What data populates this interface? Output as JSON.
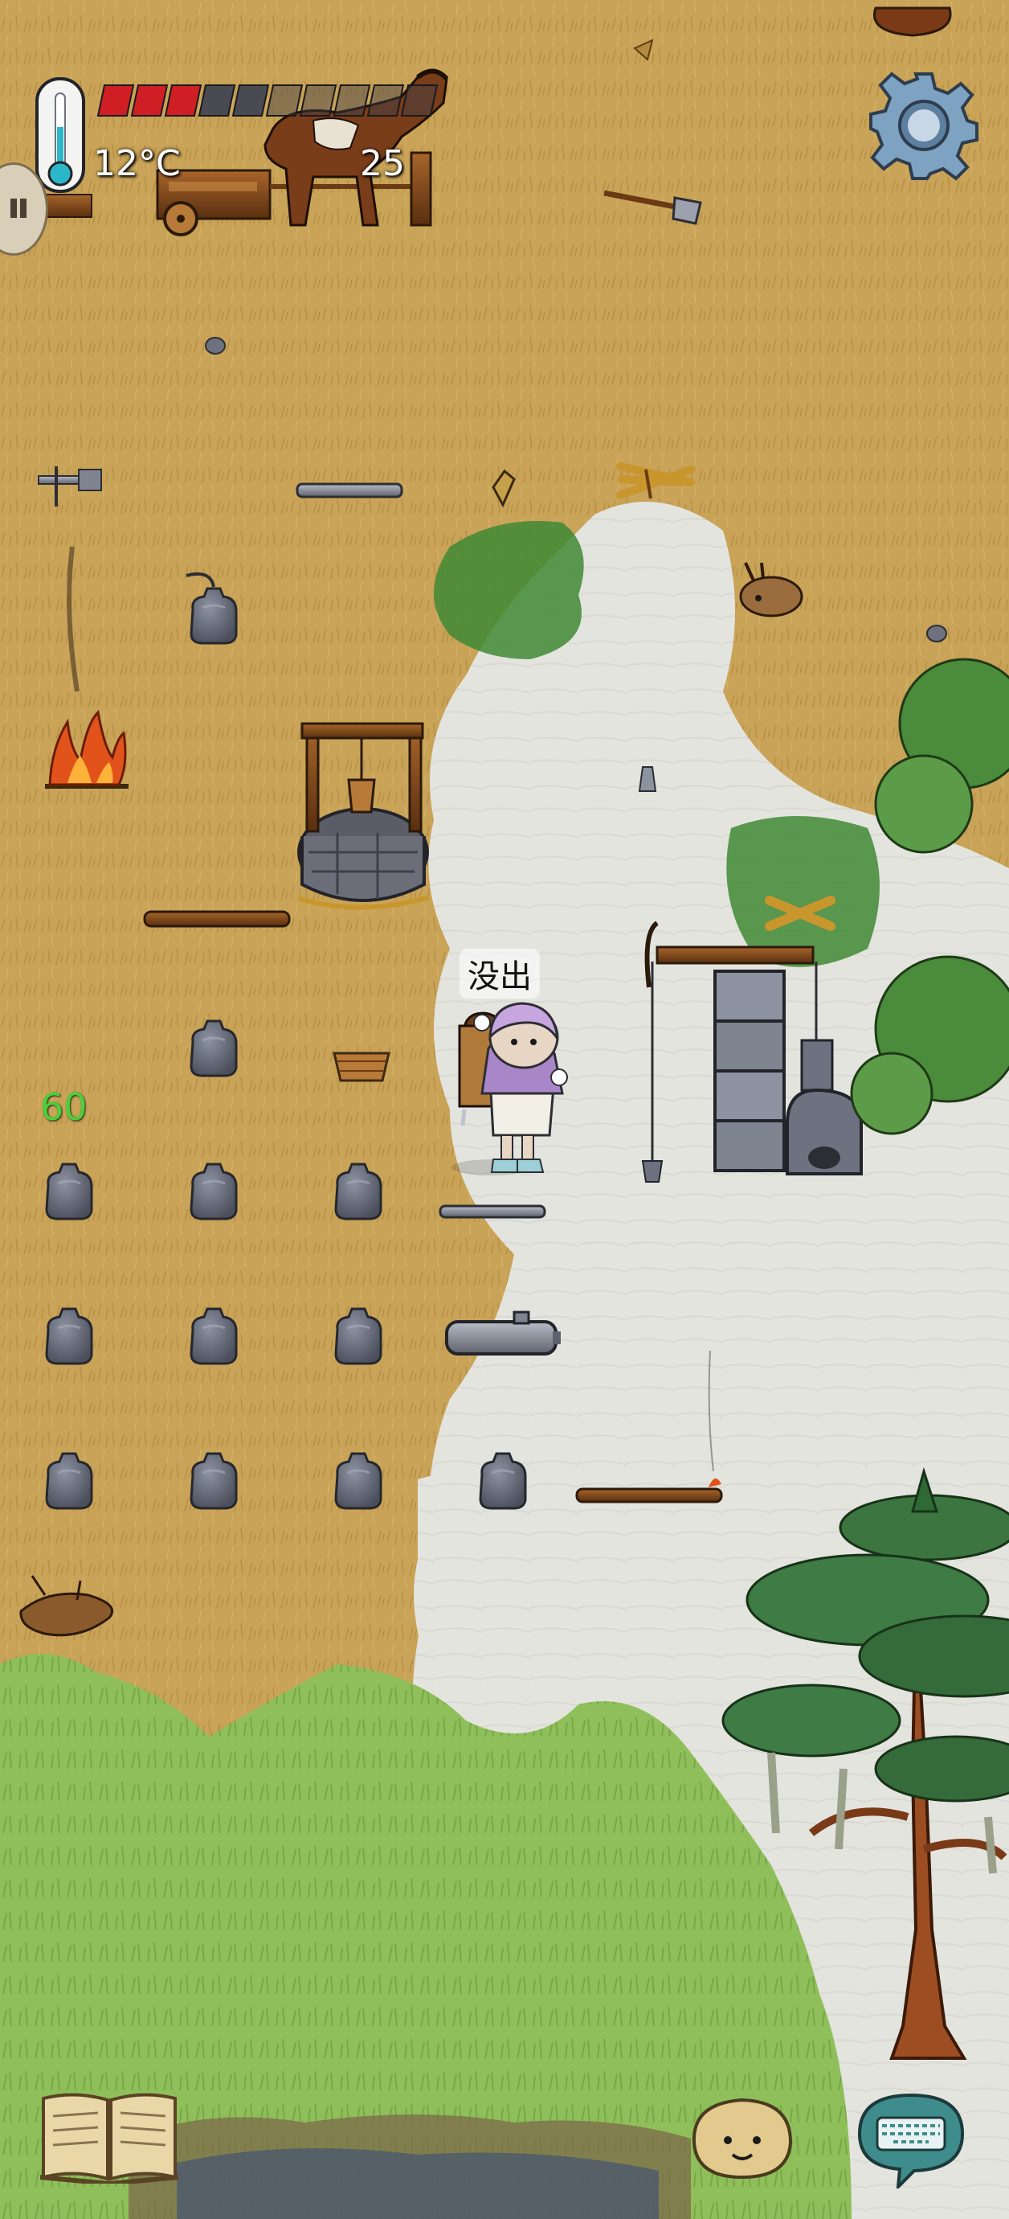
{
  "hud": {
    "temperature": "12°C",
    "temperature_fill": 0.55,
    "food_pips_total": 10,
    "food_pips_filled": 3,
    "age": "25"
  },
  "player": {
    "name_label": "没出",
    "hp_counter": "60"
  },
  "icons": {
    "settings": "gear-icon",
    "recipe_book": "book-icon",
    "emote": "emote-face-icon",
    "chat": "keyboard-icon"
  },
  "colors": {
    "grass_dry": "#c9a357",
    "snow": "#e6e6e2",
    "meadow": "#8fbf5a",
    "food_red": "#d01f24",
    "hp_green": "#4bd03a",
    "gear_blue": "#7da2c2"
  }
}
